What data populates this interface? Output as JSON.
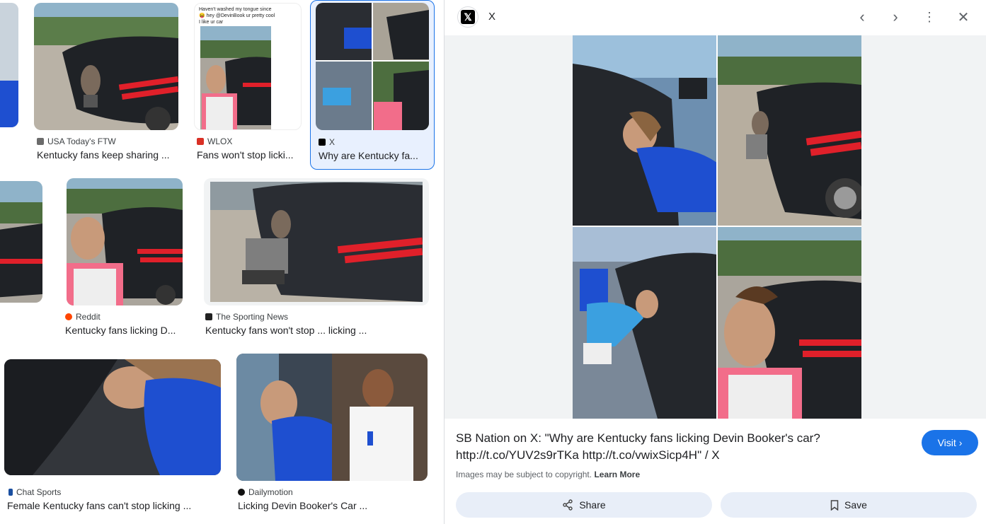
{
  "results": [
    {
      "source": "USA Today's FTW",
      "title": "Kentucky fans keep sharing ...",
      "favicon_color": "#6b6b6b"
    },
    {
      "source": "WLOX",
      "title": "Fans won't stop licki...",
      "favicon_color": "#d93025",
      "caption": "Haven't washed my tongue since 😝 hey @DevinBook ur pretty cool I like ur car"
    },
    {
      "source": "X",
      "title": "Why are Kentucky fa...",
      "favicon_color": "#000000"
    },
    {
      "source": "Reddit",
      "title": "Kentucky fans licking D...",
      "favicon_color": "#ff4500"
    },
    {
      "source": "The Sporting News",
      "title": "Kentucky fans won't stop ... licking ...",
      "favicon_color": "#222222"
    },
    {
      "source": "Chat Sports",
      "title": "Female Kentucky fans can't stop licking ...",
      "favicon_color": "#1a4fa0"
    },
    {
      "source": "Dailymotion",
      "title": "Licking Devin Booker's Car ...",
      "favicon_color": "#111111"
    }
  ],
  "panel": {
    "title": "X",
    "description": "SB Nation on X: \"Why are Kentucky fans licking Devin Booker's car? http://t.co/YUV2s9rTKa http://t.co/vwixSicp4H\" / X",
    "visit_label": "Visit",
    "copyright": "Images may be subject to copyright.",
    "learn_more": "Learn More",
    "share_label": "Share",
    "save_label": "Save"
  },
  "colors": {
    "accent": "#1a73e8",
    "car": "#2a2d33",
    "stripe": "#e0202a",
    "shirt": "#1e4fd0"
  }
}
